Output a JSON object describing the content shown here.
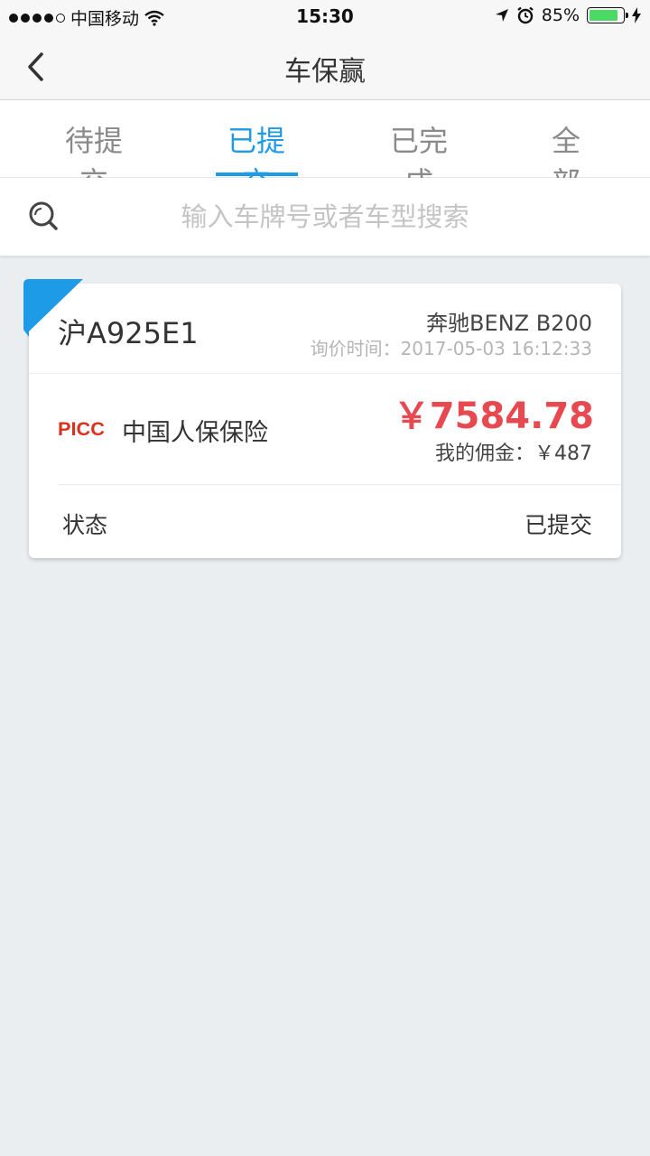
{
  "status_bar": {
    "carrier": "中国移动",
    "time": "15:30",
    "battery": "85%",
    "battery_level": 0.85
  },
  "header": {
    "title": "车保赢"
  },
  "tabs": [
    {
      "label": "待提交",
      "active": false
    },
    {
      "label": "已提交",
      "active": true
    },
    {
      "label": "已完成",
      "active": false
    },
    {
      "label": "全部",
      "active": false
    }
  ],
  "search": {
    "placeholder": "输入车牌号或者车型搜索"
  },
  "card": {
    "plate": "沪A925E1",
    "model": "奔驰BENZ B200",
    "inquiry_time": "询价时间：2017-05-03 16:12:33",
    "insurer_logo": "PICC",
    "insurer": "中国人保保险",
    "price": "￥7584.78",
    "commission": "我的佣金：￥487",
    "status_label": "状态",
    "status_value": "已提交"
  },
  "colors": {
    "accent": "#1e9be6",
    "price": "#e8484f",
    "picc": "#d8321f",
    "battery": "#4cd964"
  }
}
